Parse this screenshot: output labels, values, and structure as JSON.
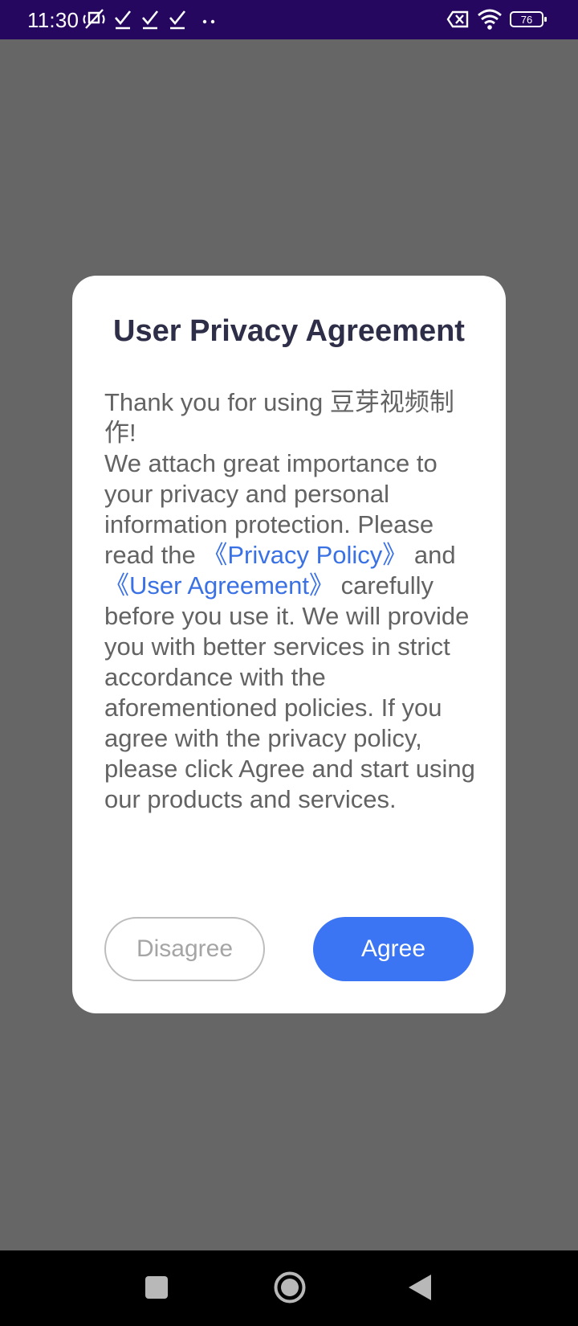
{
  "status_bar": {
    "time": "11:30",
    "battery": "76",
    "icons": [
      "mute-icon",
      "check-icon",
      "check-icon",
      "check-icon",
      "more-icon",
      "no-sim-icon",
      "wifi-icon",
      "battery-icon"
    ],
    "background": "#25075f"
  },
  "dialog": {
    "title": "User Privacy Agreement",
    "body": {
      "line1": "Thank you for using 豆芽视频制作!",
      "para_start": " We attach great importance to your privacy and personal information protection. Please read the ",
      "privacy_link": "《Privacy Policy》",
      "and": " and ",
      "user_link": "《User Agreement》",
      "para_end": " carefully before you use it. We will provide you with better services in strict accordance with the aforementioned policies. If you agree with the privacy policy, please click Agree and start using our products and services."
    },
    "buttons": {
      "disagree": "Disagree",
      "agree": "Agree"
    }
  },
  "colors": {
    "overlay": "#666666",
    "link": "#3a71e4",
    "primary": "#3b75f3",
    "title": "#2e2e48"
  },
  "nav_bar": {
    "icons": [
      "recents-icon",
      "home-icon",
      "back-icon"
    ]
  }
}
